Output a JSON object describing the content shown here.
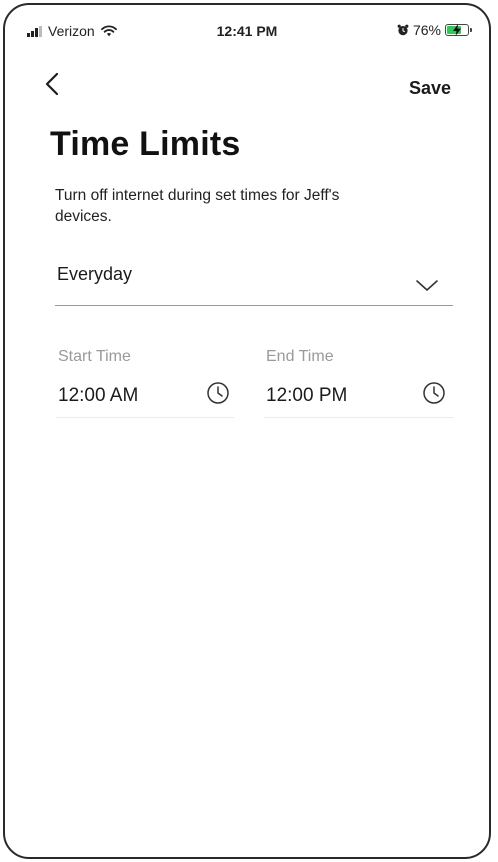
{
  "status_bar": {
    "carrier": "Verizon",
    "time": "12:41 PM",
    "battery": "76%",
    "battery_level": 0.76,
    "battery_color": "#35c759"
  },
  "nav": {
    "back_icon": "chevron-left-icon",
    "save_label": "Save"
  },
  "page": {
    "title": "Time Limits",
    "description": "Turn off internet during set times for Jeff's devices."
  },
  "schedule": {
    "selected": "Everyday",
    "icon": "chevron-down-icon"
  },
  "times": {
    "start_label": "Start Time",
    "start_value": "12:00 AM",
    "end_label": "End Time",
    "end_value": "12:00 PM",
    "icon": "clock-icon"
  }
}
